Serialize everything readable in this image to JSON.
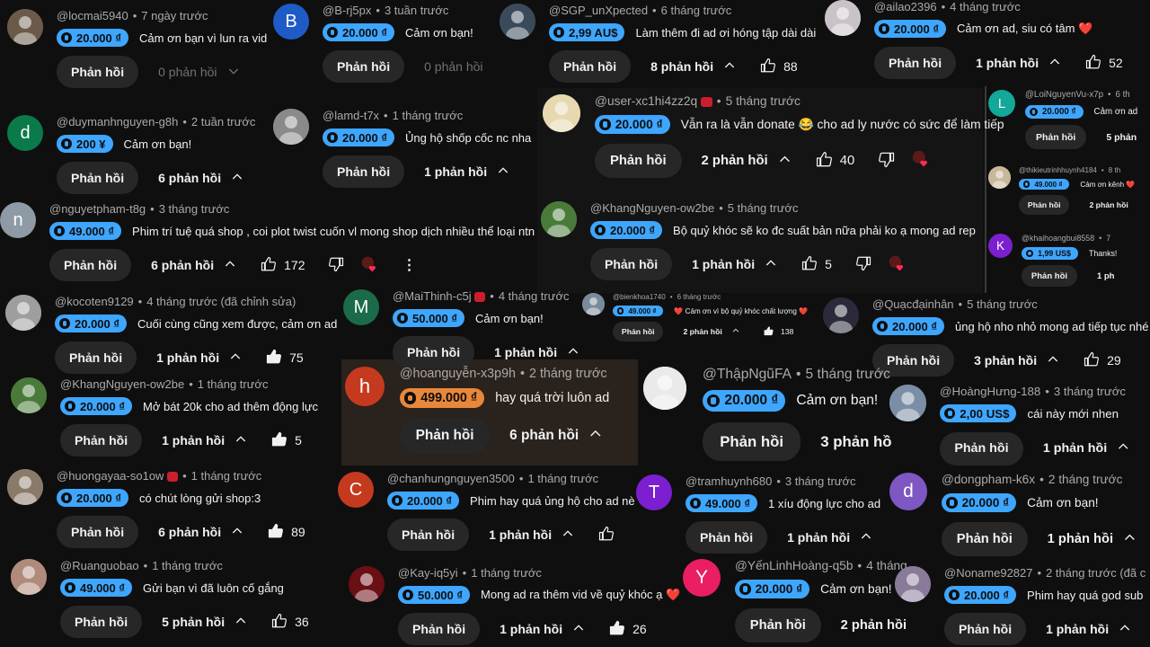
{
  "currency_icon": "donation-coin-icon",
  "colors": {
    "chip_blue": "#3ea6ff",
    "chip_orange": "#e8873a",
    "btn_bg": "#272727",
    "bg": "#0f0f0f"
  },
  "comments": [
    {
      "id": "c1",
      "username": "@locmai5940",
      "time": "7 ngày trước",
      "amount": "20.000 ₫",
      "message": "Cảm ơn bạn vì lun ra vid",
      "reply_label": "Phản hồi",
      "replies": "0 phản hồi",
      "avatar": {
        "color": "#6b5a4a",
        "letter": ""
      }
    },
    {
      "id": "c2",
      "username": "@B-rj5px",
      "time": "3 tuần trước",
      "amount": "20.000 ₫",
      "message": "Cảm ơn bạn!",
      "reply_label": "Phản hồi",
      "replies": "0 phản hồi",
      "avatar": {
        "color": "#1e5bc6",
        "letter": "B"
      }
    },
    {
      "id": "c3",
      "username": "@SGP_unXpected",
      "time": "6 tháng trước",
      "amount": "2,99 AU$",
      "message": "Làm thêm đi ad ơi hóng tập dài dài",
      "reply_label": "Phản hồi",
      "replies": "8 phản hồi",
      "likes": "88",
      "avatar": {
        "color": "#3b4a5a",
        "letter": ""
      }
    },
    {
      "id": "c4",
      "username": "@ailao2396",
      "time": "4 tháng trước",
      "amount": "20.000 ₫",
      "message": "Cảm ơn ad, siu có tâm ❤️",
      "reply_label": "Phản hồi",
      "replies": "1 phản hồi",
      "likes": "52",
      "avatar": {
        "color": "#c9c2c8",
        "letter": ""
      }
    },
    {
      "id": "c5",
      "username": "@duymanhnguyen-g8h",
      "time": "2 tuần trước",
      "amount": "200 ¥",
      "message": "Cảm ơn bạn!",
      "reply_label": "Phản hồi",
      "replies": "6 phản hồi",
      "avatar": {
        "color": "#0b7a4a",
        "letter": "d"
      }
    },
    {
      "id": "c6",
      "username": "@lamd-t7x",
      "time": "1 tháng trước",
      "amount": "20.000 ₫",
      "message": "Ủng hộ shốp cốc nc nha",
      "reply_label": "Phản hồi",
      "replies": "1 phản hồi",
      "avatar": {
        "color": "#8a8a8a",
        "letter": ""
      }
    },
    {
      "id": "c7",
      "username": "@user-xc1hi4zz2q",
      "time": "5 tháng trước",
      "amount": "20.000 ₫",
      "message": "Vẫn ra là vẫn donate 😂 cho ad ly nước có sức để làm tiếp",
      "reply_label": "Phản hồi",
      "replies": "2 phản hồi",
      "likes": "40",
      "avatar": {
        "color": "#e8d8b0",
        "letter": ""
      }
    },
    {
      "id": "c8",
      "username": "@LoiNguyenVu-x7p",
      "time": "6 th",
      "amount": "20.000 ₫",
      "message": "Cảm ơn ad",
      "reply_label": "Phản hồi",
      "replies": "5 phản",
      "avatar": {
        "color": "#12a89a",
        "letter": "L"
      }
    },
    {
      "id": "c9",
      "username": "@thikieutrinhhuynh4184",
      "time": "8 th",
      "amount": "49.000 ₫",
      "message": "Cảm ơn kênh ❤️",
      "reply_label": "Phản hồi",
      "replies": "2 phản hồi",
      "avatar": {
        "color": "#c8b89a",
        "letter": ""
      }
    },
    {
      "id": "c10",
      "username": "@nguyetpham-t8g",
      "time": "3 tháng trước",
      "amount": "49.000 ₫",
      "message": "Phim trí tuệ quá shop , coi plot twist cuốn vl mong shop dịch nhiều thể loại ntn",
      "reply_label": "Phản hồi",
      "replies": "6 phản hồi",
      "likes": "172",
      "avatar": {
        "color": "#8e9aa5",
        "letter": "n"
      }
    },
    {
      "id": "c11",
      "username": "@KhangNguyen-ow2be",
      "time": "5 tháng trước",
      "amount": "20.000 ₫",
      "message": "Bộ quỷ khóc sẽ ko đc suất bản nữa phải ko ạ mong ad rep",
      "reply_label": "Phản hồi",
      "replies": "1 phản hồi",
      "likes": "5",
      "avatar": {
        "color": "#4a7a3a",
        "letter": ""
      }
    },
    {
      "id": "c12",
      "username": "@khaihoangbui8558",
      "time": "7",
      "amount": "1,99 US$",
      "message": "Thanks!",
      "reply_label": "Phản hồi",
      "replies": "1 ph",
      "avatar": {
        "color": "#7b1fd0",
        "letter": "K"
      }
    },
    {
      "id": "c13",
      "username": "@kocoten9129",
      "time": "4 tháng trước (đã chỉnh sửa)",
      "amount": "20.000 ₫",
      "message": "Cuối cùng cũng xem được, cảm ơn ad",
      "reply_label": "Phản hồi",
      "replies": "1 phản hồi",
      "likes": "75",
      "avatar": {
        "color": "#9e9e9e",
        "letter": ""
      }
    },
    {
      "id": "c14",
      "username": "@MaiThinh-c5j",
      "time": "4 tháng trước",
      "amount": "50.000 ₫",
      "message": "Cảm ơn bạn!",
      "reply_label": "Phản hồi",
      "replies": "1 phản hồi",
      "avatar": {
        "color": "#1b6b4a",
        "letter": "M"
      }
    },
    {
      "id": "c15",
      "username": "@bienkhoa1740",
      "time": "6 tháng trước",
      "amount": "49.000 ₫",
      "message": "❤️ Cảm ơn vì bộ quỷ khóc chất lượng ❤️",
      "reply_label": "Phản hồi",
      "replies": "2 phản hồi",
      "likes": "138",
      "avatar": {
        "color": "#7a8a9a",
        "letter": ""
      }
    },
    {
      "id": "c16",
      "username": "@Quạcđạinhân",
      "time": "5 tháng trước",
      "amount": "20.000 ₫",
      "message": "ủng hộ nho nhỏ mong ad tiếp tục nhé",
      "reply_label": "Phản hồi",
      "replies": "3 phản hồi",
      "likes": "29",
      "avatar": {
        "color": "#2a2a3a",
        "letter": ""
      }
    },
    {
      "id": "c17",
      "username": "@KhangNguyen-ow2be",
      "time": "1 tháng trước",
      "amount": "20.000 ₫",
      "message": "Mở bát 20k cho ad thêm động lực",
      "reply_label": "Phản hồi",
      "replies": "1 phản hồi",
      "likes": "5",
      "avatar": {
        "color": "#4a7a3a",
        "letter": ""
      }
    },
    {
      "id": "c18",
      "username": "@hoanguyễn-x3p9h",
      "time": "2 tháng trước",
      "amount": "499.000 ₫",
      "message": "hay quá trời luôn ad",
      "reply_label": "Phản hồi",
      "replies": "6 phản hồi",
      "avatar": {
        "color": "#c53a1e",
        "letter": "h"
      }
    },
    {
      "id": "c19",
      "username": "@ThậpNgũFA",
      "time": "5 tháng trước",
      "amount": "20.000 ₫",
      "message": "Cảm ơn bạn!",
      "reply_label": "Phản hồi",
      "replies": "3 phản hồ",
      "avatar": {
        "color": "#eaeaea",
        "letter": ""
      }
    },
    {
      "id": "c20",
      "username": "@HoàngHưng-188",
      "time": "3 tháng trước",
      "amount": "2,00 US$",
      "message": "cái này mới nhen",
      "reply_label": "Phản hồi",
      "replies": "1 phản hồi",
      "avatar": {
        "color": "#7a8fa5",
        "letter": ""
      }
    },
    {
      "id": "c21",
      "username": "@huongayaa-so1ow",
      "time": "1 tháng trước",
      "amount": "20.000 ₫",
      "message": "có chút lòng gửi shop:3",
      "reply_label": "Phản hồi",
      "replies": "6 phản hồi",
      "likes": "89",
      "avatar": {
        "color": "#8a7a6a",
        "letter": ""
      }
    },
    {
      "id": "c22",
      "username": "@chanhungnguyen3500",
      "time": "1 tháng trước",
      "amount": "20.000 ₫",
      "message": "Phim hay quá ủng hộ cho ad nè",
      "reply_label": "Phản hồi",
      "replies": "1 phản hồi",
      "avatar": {
        "color": "#c53a1e",
        "letter": "C"
      }
    },
    {
      "id": "c23",
      "username": "@tramhuynh680",
      "time": "3 tháng trước",
      "amount": "49.000 ₫",
      "message": "1 xíu động lực cho ad",
      "reply_label": "Phản hồi",
      "replies": "1 phản hồi",
      "avatar": {
        "color": "#7b1fd0",
        "letter": "T"
      }
    },
    {
      "id": "c24",
      "username": "@dongpham-k6x",
      "time": "2 tháng trước",
      "amount": "20.000 ₫",
      "message": "Cảm ơn bạn!",
      "reply_label": "Phản hồi",
      "replies": "1 phản hồi",
      "avatar": {
        "color": "#7e57c2",
        "letter": "d"
      }
    },
    {
      "id": "c25",
      "username": "@Ruanguobao",
      "time": "1 tháng trước",
      "amount": "49.000 ₫",
      "message": "Gửi bạn vì đã luôn cố gắng",
      "reply_label": "Phản hồi",
      "replies": "5 phản hồi",
      "likes": "36",
      "avatar": {
        "color": "#b08a7a",
        "letter": ""
      }
    },
    {
      "id": "c26",
      "username": "@Kay-iq5yi",
      "time": "1 tháng trước",
      "amount": "50.000 ₫",
      "message": "Mong ad ra thêm vid về quỷ khóc ạ ❤️",
      "reply_label": "Phản hồi",
      "replies": "1 phản hồi",
      "likes": "26",
      "avatar": {
        "color": "#6a0f14",
        "letter": ""
      }
    },
    {
      "id": "c27",
      "username": "@YếnLinhHoàng-q5b",
      "time": "4 tháng",
      "amount": "20.000 ₫",
      "message": "Cảm ơn bạn!",
      "reply_label": "Phản hồi",
      "replies": "2 phản hồi",
      "avatar": {
        "color": "#e91e63",
        "letter": "Y"
      }
    },
    {
      "id": "c28",
      "username": "@Noname92827",
      "time": "2 tháng trước (đã c",
      "amount": "20.000 ₫",
      "message": "Phim hay quá god sub",
      "reply_label": "Phản hồi",
      "replies": "1 phản hồi",
      "avatar": {
        "color": "#8a7a9a",
        "letter": ""
      }
    }
  ]
}
